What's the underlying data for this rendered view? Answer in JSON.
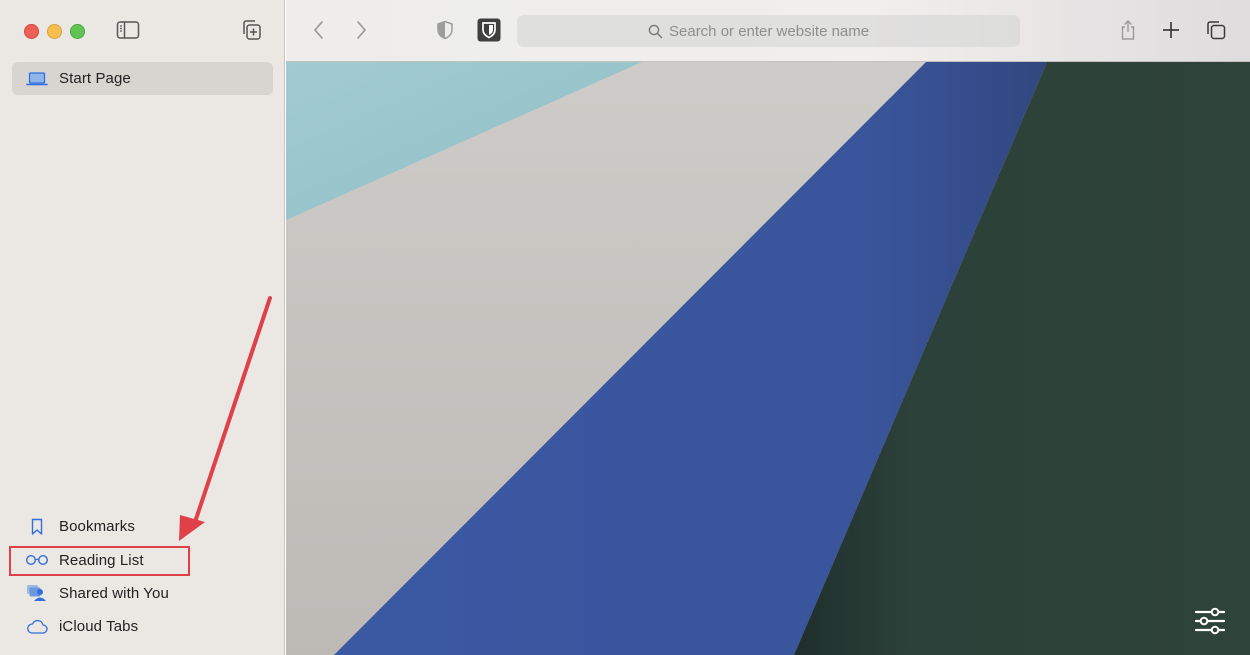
{
  "window": {
    "traffic_lights": [
      "close",
      "minimize",
      "zoom"
    ]
  },
  "sidebar": {
    "toggle_icon": "sidebar-toggle-icon",
    "new_tab_group_icon": "new-tab-group-icon",
    "top_items": [
      {
        "label": "Start Page",
        "icon": "laptop-icon",
        "selected": true
      }
    ],
    "bottom_items": [
      {
        "label": "Bookmarks",
        "icon": "bookmark-icon"
      },
      {
        "label": "Reading List",
        "icon": "glasses-icon"
      },
      {
        "label": "Shared with You",
        "icon": "shared-people-icon"
      },
      {
        "label": "iCloud Tabs",
        "icon": "cloud-icon"
      }
    ]
  },
  "toolbar": {
    "back_icon": "chevron-left-icon",
    "forward_icon": "chevron-right-icon",
    "privacy_icon": "shield-icon",
    "extension_icon": "bitwarden-shield-icon",
    "search": {
      "value": "",
      "placeholder": "Search or enter website name"
    },
    "share_icon": "share-icon",
    "new_tab_icon": "plus-icon",
    "tab_overview_icon": "tabs-overview-icon"
  },
  "content": {
    "customize_icon": "sliders-icon",
    "colors": {
      "teal": "#9bc6cc",
      "gray": "#c9c6c3",
      "blue": "#3a56a0",
      "green": "#2e4339"
    }
  },
  "annotation": {
    "highlighted_item": "Reading List",
    "color": "#e04048"
  },
  "colors": {
    "accent": "#2f6fe0",
    "sidebar_bg": "#ebe7e3",
    "selected_bg": "#d8d4d0"
  }
}
